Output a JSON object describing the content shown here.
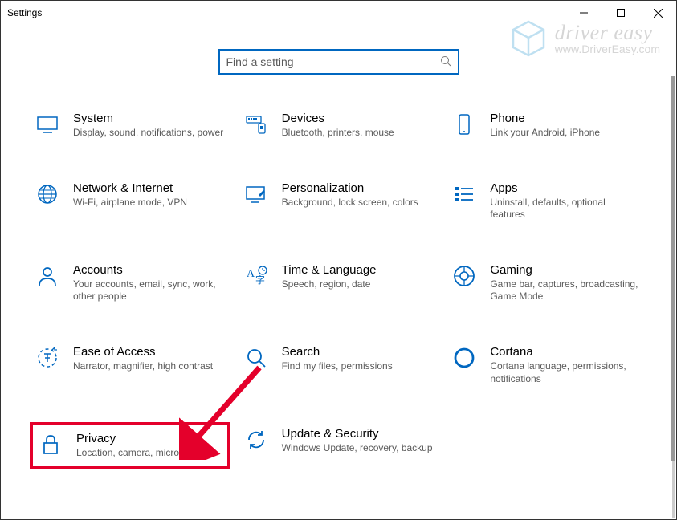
{
  "window": {
    "title": "Settings"
  },
  "search": {
    "placeholder": "Find a setting"
  },
  "tiles": [
    {
      "title": "System",
      "sub": "Display, sound, notifications, power"
    },
    {
      "title": "Devices",
      "sub": "Bluetooth, printers, mouse"
    },
    {
      "title": "Phone",
      "sub": "Link your Android, iPhone"
    },
    {
      "title": "Network & Internet",
      "sub": "Wi-Fi, airplane mode, VPN"
    },
    {
      "title": "Personalization",
      "sub": "Background, lock screen, colors"
    },
    {
      "title": "Apps",
      "sub": "Uninstall, defaults, optional features"
    },
    {
      "title": "Accounts",
      "sub": "Your accounts, email, sync, work, other people"
    },
    {
      "title": "Time & Language",
      "sub": "Speech, region, date"
    },
    {
      "title": "Gaming",
      "sub": "Game bar, captures, broadcasting, Game Mode"
    },
    {
      "title": "Ease of Access",
      "sub": "Narrator, magnifier, high contrast"
    },
    {
      "title": "Search",
      "sub": "Find my files, permissions"
    },
    {
      "title": "Cortana",
      "sub": "Cortana language, permissions, notifications"
    },
    {
      "title": "Privacy",
      "sub": "Location, camera, microphone"
    },
    {
      "title": "Update & Security",
      "sub": "Windows Update, recovery, backup"
    }
  ],
  "watermark": {
    "brand": "driver easy",
    "url": "www.DriverEasy.com"
  }
}
